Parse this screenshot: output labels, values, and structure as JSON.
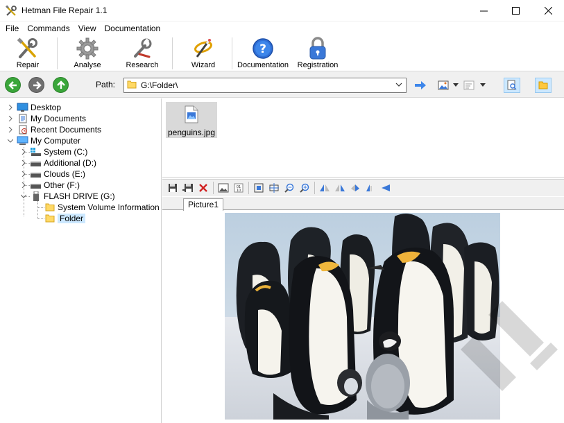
{
  "window": {
    "title": "Hetman File Repair 1.1"
  },
  "menu": [
    "File",
    "Commands",
    "View",
    "Documentation"
  ],
  "toolbar": [
    {
      "label": "Repair",
      "icon": "repair-tools-icon"
    },
    {
      "label": "Analyse",
      "icon": "gear-icon"
    },
    {
      "label": "Research",
      "icon": "wrench-icon"
    },
    {
      "label": "Wizard",
      "icon": "wizard-wand-icon"
    },
    {
      "label": "Documentation",
      "icon": "help-icon"
    },
    {
      "label": "Registration",
      "icon": "padlock-icon"
    }
  ],
  "nav": {
    "path_label": "Path:",
    "path_value": "G:\\Folder\\"
  },
  "tree": {
    "desktop": "Desktop",
    "my_documents": "My Documents",
    "recent_documents": "Recent Documents",
    "my_computer": "My Computer",
    "system": "System (C:)",
    "additional": "Additional (D:)",
    "clouds": "Clouds (E:)",
    "other": "Other (F:)",
    "flash": "FLASH DRIVE (G:)",
    "svi": "System Volume Information",
    "folder": "Folder"
  },
  "files": [
    {
      "name": "penguins.jpg"
    }
  ],
  "preview": {
    "tab": "Picture1"
  },
  "colors": {
    "selection": "#cce8ff",
    "nav_green": "#3aa63a",
    "nav_grey": "#707070",
    "folder_yellow": "#ffd966"
  }
}
